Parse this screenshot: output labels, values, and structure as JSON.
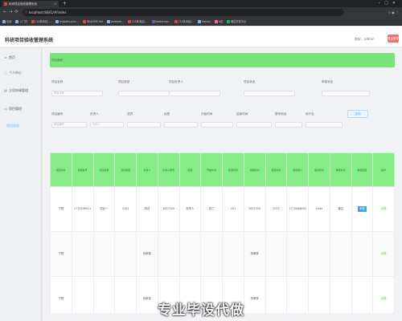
{
  "browser": {
    "tab_title": "科研项目验收管理系统",
    "url": "localhost:8081/#/index",
    "bookmarks": [
      "应用",
      "入门页",
      "(12条消息) …",
      "mybatis-plus…",
      "README.md",
      "javaweb…",
      "(12条消息)…",
      "bootstrap…",
      "(12条消息)…",
      "bejson",
      "b站",
      "微信开放平台"
    ]
  },
  "app": {
    "title": "科研项目验收管理系统",
    "greeting": "你好，admin",
    "logout": "退出登录"
  },
  "sidebar": {
    "items": [
      {
        "label": "首页",
        "icon": "home-icon"
      },
      {
        "label": "个人中心",
        "icon": "user-icon"
      },
      {
        "label": "立项申请管理",
        "icon": "document-icon"
      },
      {
        "label": "项目管理",
        "icon": "folder-icon"
      }
    ],
    "active_sub": "项目验收"
  },
  "banner": {
    "label": "项目验收"
  },
  "filters": {
    "row1": [
      {
        "label": "项目名称",
        "placeholder": "项目名称"
      },
      {
        "label": "项目类型",
        "placeholder": ""
      },
      {
        "label": "项目负责人",
        "placeholder": ""
      },
      {
        "label": "项目状态",
        "placeholder": ""
      },
      {
        "label": "审核状态",
        "placeholder": ""
      }
    ],
    "row2": [
      {
        "label": "项目编号",
        "placeholder": "项目编号"
      },
      {
        "label": "负责人",
        "placeholder": "负责人"
      },
      {
        "label": "成员",
        "placeholder": ""
      },
      {
        "label": "经费",
        "placeholder": ""
      },
      {
        "label": "开始时间",
        "placeholder": ""
      },
      {
        "label": "结束时间",
        "placeholder": ""
      },
      {
        "label": "联系电话",
        "placeholder": ""
      },
      {
        "label": "用户名",
        "placeholder": ""
      }
    ],
    "query_btn": "查询"
  },
  "table": {
    "headers": [
      "项目文件",
      "项目编号",
      "项目名称",
      "项目类型",
      "负责人",
      "负责人账号",
      "经费",
      "开始时间",
      "结束时间",
      "验收时间",
      "项目状态",
      "项目简介",
      "提交时间",
      "审核状态",
      "审核回复",
      "操作"
    ],
    "rows": [
      [
        "下载",
        "1770296911",
        "项目一",
        "4102",
        "测试",
        "1637520",
        "负责人",
        "张三",
        "201",
        "1637520",
        "2022",
        "1770546893",
        "5444",
        "通过",
        "审核",
        "详情"
      ],
      [
        "下载",
        "",
        "",
        "",
        "待审核",
        "",
        "",
        "",
        "",
        "待审核",
        "",
        "",
        "",
        "",
        "",
        "详情"
      ],
      [
        "下载",
        "",
        "",
        "",
        "待审核",
        "",
        "",
        "",
        "",
        "待审核",
        "",
        "",
        "",
        "",
        "",
        "详情"
      ]
    ]
  },
  "caption": "专业毕设代做",
  "pager": "1"
}
